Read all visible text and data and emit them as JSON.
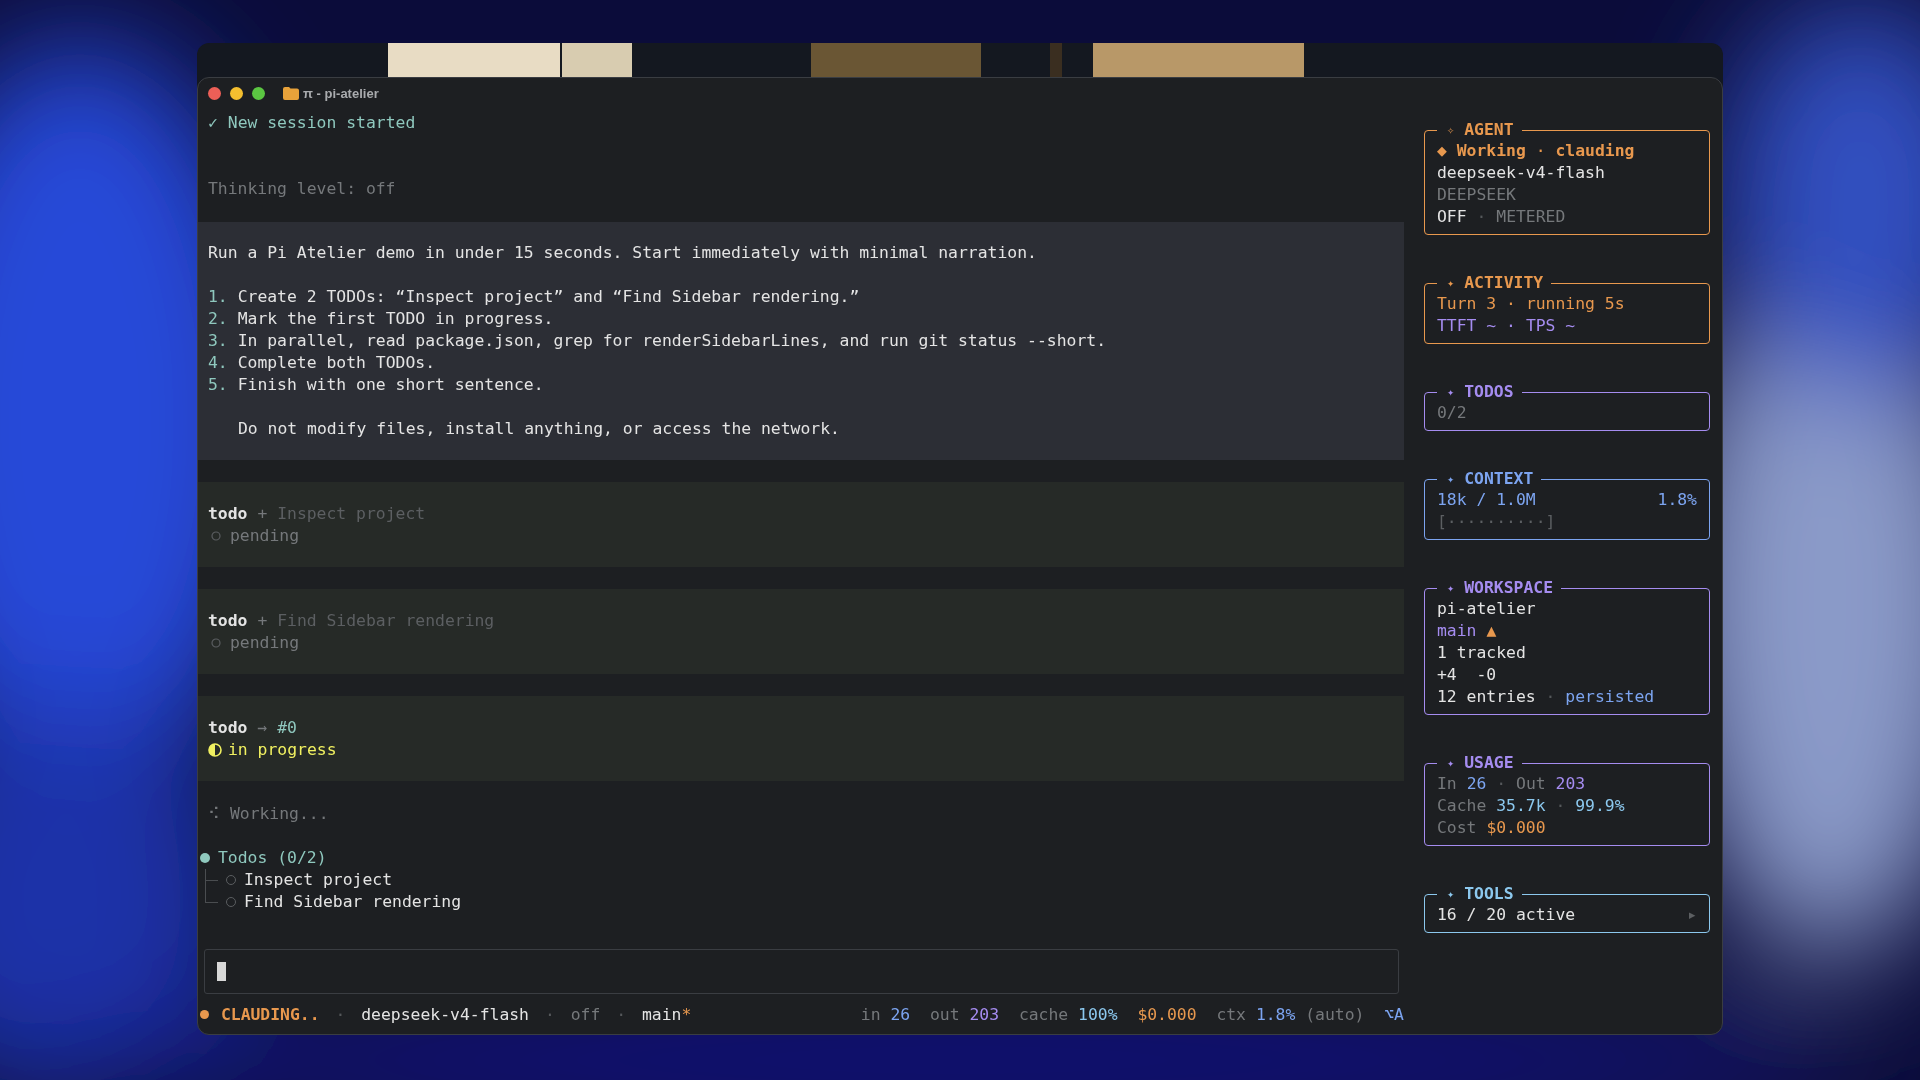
{
  "window": {
    "title": "π - pi-atelier"
  },
  "transcript": [
    {
      "kind": "notice",
      "icon": "✓",
      "text": "New session started"
    },
    {
      "kind": "info",
      "text": "Thinking level: off"
    },
    {
      "kind": "prompt",
      "intro": "Run a Pi Atelier demo in under 15 seconds. Start immediately with minimal narration.",
      "steps": [
        {
          "number": "1.",
          "text": "Create 2 TODOs: “Inspect project” and “Find Sidebar rendering.”"
        },
        {
          "number": "2.",
          "text": "Mark the first TODO in progress."
        },
        {
          "number": "3.",
          "text": "In parallel, read package.json, grep for renderSidebarLines, and run git status --short."
        },
        {
          "number": "4.",
          "text": "Complete both TODOs."
        },
        {
          "number": "5.",
          "text": "Finish with one short sentence."
        }
      ],
      "note": "Do not modify files, install anything, or access the network."
    },
    {
      "kind": "tool",
      "tool": "todo",
      "op": {
        "kind": "add",
        "text": "+"
      },
      "arg": "Inspect project",
      "status": {
        "kind": "pending",
        "text": "pending"
      }
    },
    {
      "kind": "tool",
      "tool": "todo",
      "op": {
        "kind": "add",
        "text": "+"
      },
      "arg": "Find Sidebar rendering",
      "status": {
        "kind": "pending",
        "text": "pending"
      }
    },
    {
      "kind": "tool",
      "tool": "todo",
      "op": {
        "kind": "update",
        "text": "→"
      },
      "arg": "#0",
      "status": {
        "kind": "progress",
        "text": "in progress"
      }
    },
    {
      "kind": "working",
      "icon": "⠪",
      "text": "Working..."
    },
    {
      "kind": "tree",
      "title": "Todos (0/2)",
      "items": [
        {
          "text": "Inspect project",
          "checked": false
        },
        {
          "text": "Find Sidebar rendering",
          "checked": false
        }
      ]
    }
  ],
  "status_bar": {
    "left": [
      {
        "text": "CLAUDING..",
        "kind": "agent"
      },
      {
        "text": "·",
        "kind": "sep"
      },
      {
        "text": "deepseek-v4-flash",
        "kind": "plain"
      },
      {
        "text": "·",
        "kind": "sep"
      },
      {
        "text": "off",
        "kind": "muted"
      },
      {
        "text": "·",
        "kind": "sep"
      },
      {
        "text": "main",
        "kind": "plain"
      },
      {
        "text": "*",
        "kind": "dirty"
      }
    ],
    "right": [
      {
        "text": "in",
        "kind": "label"
      },
      {
        "text": "26",
        "kind": "input"
      },
      {
        "text": "out",
        "kind": "label"
      },
      {
        "text": "203",
        "kind": "output"
      },
      {
        "text": "cache",
        "kind": "label"
      },
      {
        "text": "100%",
        "kind": "cache"
      },
      {
        "text": "$0.000",
        "kind": "cost"
      },
      {
        "text": "ctx",
        "kind": "label"
      },
      {
        "text": "1.8%",
        "kind": "input"
      },
      {
        "text": "(auto)",
        "kind": "muted"
      },
      {
        "text": "⌥A",
        "kind": "key"
      }
    ]
  },
  "sidebar": {
    "panels": [
      {
        "icon": "✧",
        "title": "AGENT",
        "color": "#e8984e",
        "lines": [
          {
            "segments": [
              {
                "text": "◆ Working",
                "kind": "agent"
              },
              {
                "text": "·",
                "kind": "warm"
              },
              {
                "text": "clauding",
                "kind": "agent"
              }
            ]
          },
          {
            "segments": [
              {
                "text": "deepseek-v4-flash",
                "kind": "plain"
              }
            ]
          },
          {
            "segments": [
              {
                "text": "DEEPSEEK",
                "kind": "muted"
              }
            ]
          },
          {
            "segments": [
              {
                "text": "OFF",
                "kind": "plain"
              },
              {
                "text": "·",
                "kind": "sep"
              },
              {
                "text": "METERED",
                "kind": "muted"
              }
            ]
          }
        ]
      },
      {
        "icon": "✦",
        "title": "ACTIVITY",
        "color": "#e8984e",
        "lines": [
          {
            "segments": [
              {
                "text": "Turn 3",
                "kind": "warm"
              },
              {
                "text": "·",
                "kind": "warm"
              },
              {
                "text": "running 5s",
                "kind": "warm"
              }
            ]
          },
          {
            "segments": [
              {
                "text": "TTFT ~",
                "kind": "output"
              },
              {
                "text": "·",
                "kind": "output"
              },
              {
                "text": "TPS ~",
                "kind": "output"
              }
            ]
          }
        ]
      },
      {
        "icon": "✦",
        "title": "TODOS",
        "color": "#a58cf0",
        "lines": [
          {
            "segments": [
              {
                "text": "0/2",
                "kind": "muted"
              }
            ]
          }
        ]
      },
      {
        "icon": "✦",
        "title": "CONTEXT",
        "color": "#7ca4f0",
        "lines": [
          {
            "segments": [
              {
                "text": "18k / 1.0M",
                "kind": "input"
              }
            ],
            "trailing": [
              {
                "text": "1.8%",
                "kind": "input"
              }
            ]
          },
          {
            "segments": [
              {
                "text": "[··········]",
                "kind": "faint"
              }
            ]
          }
        ]
      },
      {
        "icon": "✦",
        "title": "WORKSPACE",
        "color": "#a58cf0",
        "lines": [
          {
            "segments": [
              {
                "text": "pi-atelier",
                "kind": "plain"
              }
            ]
          },
          {
            "segments": [
              {
                "text": "main",
                "kind": "output"
              },
              {
                "text": "▲",
                "kind": "warm"
              }
            ]
          },
          {
            "segments": [
              {
                "text": "1 tracked",
                "kind": "plain"
              }
            ]
          },
          {
            "segments": [
              {
                "text": "+4  -0",
                "kind": "plain"
              }
            ]
          },
          {
            "segments": [
              {
                "text": "12 entries",
                "kind": "plain"
              },
              {
                "text": "·",
                "kind": "sep"
              },
              {
                "text": "persisted",
                "kind": "input"
              }
            ]
          }
        ]
      },
      {
        "icon": "✦",
        "title": "USAGE",
        "color": "#a58cf0",
        "lines": [
          {
            "segments": [
              {
                "text": "In",
                "kind": "muted"
              },
              {
                "text": "26",
                "kind": "input"
              },
              {
                "text": "·",
                "kind": "sep"
              },
              {
                "text": "Out",
                "kind": "muted"
              },
              {
                "text": "203",
                "kind": "output"
              }
            ]
          },
          {
            "segments": [
              {
                "text": "Cache",
                "kind": "muted"
              },
              {
                "text": "35.7k",
                "kind": "cache"
              },
              {
                "text": "·",
                "kind": "sep"
              },
              {
                "text": "99.9%",
                "kind": "cache"
              }
            ]
          },
          {
            "segments": [
              {
                "text": "Cost",
                "kind": "muted"
              },
              {
                "text": "$0.000",
                "kind": "warm"
              }
            ]
          }
        ]
      },
      {
        "icon": "✦",
        "title": "TOOLS",
        "color": "#8cc8ee",
        "lines": [
          {
            "segments": [
              {
                "text": "16 / 20 active",
                "kind": "plain"
              }
            ],
            "trailing": [
              {
                "text": "▸",
                "kind": "faint"
              }
            ]
          }
        ]
      }
    ]
  }
}
